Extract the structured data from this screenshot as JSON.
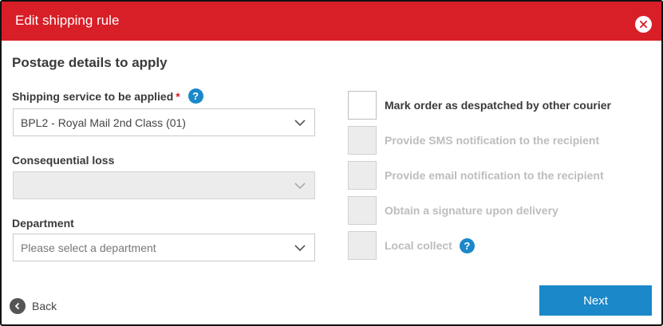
{
  "dialog": {
    "title": "Edit shipping rule",
    "close_icon": "close-icon",
    "accent_color": "#d81e27",
    "primary_color": "#1a88c9"
  },
  "section": {
    "title": "Postage details to apply"
  },
  "fields": {
    "shipping_service": {
      "label": "Shipping service to be applied",
      "required_marker": "*",
      "help": "?",
      "value": "BPL2 - Royal Mail 2nd Class (01)"
    },
    "consequential_loss": {
      "label": "Consequential loss",
      "value": ""
    },
    "department": {
      "label": "Department",
      "placeholder": "Please select a department"
    }
  },
  "options": [
    {
      "label": "Mark order as despatched by other courier",
      "enabled": true,
      "checked": false
    },
    {
      "label": "Provide SMS notification to the recipient",
      "enabled": false,
      "checked": false
    },
    {
      "label": "Provide email notification to the recipient",
      "enabled": false,
      "checked": false
    },
    {
      "label": "Obtain a signature upon delivery",
      "enabled": false,
      "checked": false
    },
    {
      "label": "Local collect",
      "enabled": false,
      "checked": false,
      "help": "?"
    }
  ],
  "footer": {
    "back_label": "Back",
    "next_label": "Next"
  }
}
